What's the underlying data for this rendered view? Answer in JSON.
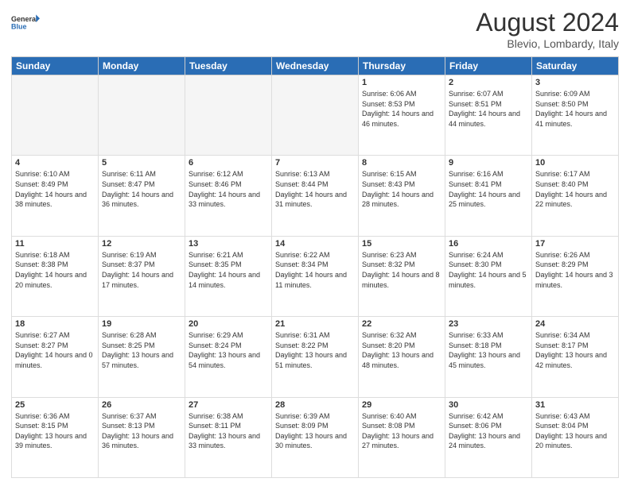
{
  "logo": {
    "line1": "General",
    "line2": "Blue"
  },
  "title": "August 2024",
  "subtitle": "Blevio, Lombardy, Italy",
  "weekdays": [
    "Sunday",
    "Monday",
    "Tuesday",
    "Wednesday",
    "Thursday",
    "Friday",
    "Saturday"
  ],
  "weeks": [
    [
      {
        "day": "",
        "info": ""
      },
      {
        "day": "",
        "info": ""
      },
      {
        "day": "",
        "info": ""
      },
      {
        "day": "",
        "info": ""
      },
      {
        "day": "1",
        "info": "Sunrise: 6:06 AM\nSunset: 8:53 PM\nDaylight: 14 hours and 46 minutes."
      },
      {
        "day": "2",
        "info": "Sunrise: 6:07 AM\nSunset: 8:51 PM\nDaylight: 14 hours and 44 minutes."
      },
      {
        "day": "3",
        "info": "Sunrise: 6:09 AM\nSunset: 8:50 PM\nDaylight: 14 hours and 41 minutes."
      }
    ],
    [
      {
        "day": "4",
        "info": "Sunrise: 6:10 AM\nSunset: 8:49 PM\nDaylight: 14 hours and 38 minutes."
      },
      {
        "day": "5",
        "info": "Sunrise: 6:11 AM\nSunset: 8:47 PM\nDaylight: 14 hours and 36 minutes."
      },
      {
        "day": "6",
        "info": "Sunrise: 6:12 AM\nSunset: 8:46 PM\nDaylight: 14 hours and 33 minutes."
      },
      {
        "day": "7",
        "info": "Sunrise: 6:13 AM\nSunset: 8:44 PM\nDaylight: 14 hours and 31 minutes."
      },
      {
        "day": "8",
        "info": "Sunrise: 6:15 AM\nSunset: 8:43 PM\nDaylight: 14 hours and 28 minutes."
      },
      {
        "day": "9",
        "info": "Sunrise: 6:16 AM\nSunset: 8:41 PM\nDaylight: 14 hours and 25 minutes."
      },
      {
        "day": "10",
        "info": "Sunrise: 6:17 AM\nSunset: 8:40 PM\nDaylight: 14 hours and 22 minutes."
      }
    ],
    [
      {
        "day": "11",
        "info": "Sunrise: 6:18 AM\nSunset: 8:38 PM\nDaylight: 14 hours and 20 minutes."
      },
      {
        "day": "12",
        "info": "Sunrise: 6:19 AM\nSunset: 8:37 PM\nDaylight: 14 hours and 17 minutes."
      },
      {
        "day": "13",
        "info": "Sunrise: 6:21 AM\nSunset: 8:35 PM\nDaylight: 14 hours and 14 minutes."
      },
      {
        "day": "14",
        "info": "Sunrise: 6:22 AM\nSunset: 8:34 PM\nDaylight: 14 hours and 11 minutes."
      },
      {
        "day": "15",
        "info": "Sunrise: 6:23 AM\nSunset: 8:32 PM\nDaylight: 14 hours and 8 minutes."
      },
      {
        "day": "16",
        "info": "Sunrise: 6:24 AM\nSunset: 8:30 PM\nDaylight: 14 hours and 5 minutes."
      },
      {
        "day": "17",
        "info": "Sunrise: 6:26 AM\nSunset: 8:29 PM\nDaylight: 14 hours and 3 minutes."
      }
    ],
    [
      {
        "day": "18",
        "info": "Sunrise: 6:27 AM\nSunset: 8:27 PM\nDaylight: 14 hours and 0 minutes."
      },
      {
        "day": "19",
        "info": "Sunrise: 6:28 AM\nSunset: 8:25 PM\nDaylight: 13 hours and 57 minutes."
      },
      {
        "day": "20",
        "info": "Sunrise: 6:29 AM\nSunset: 8:24 PM\nDaylight: 13 hours and 54 minutes."
      },
      {
        "day": "21",
        "info": "Sunrise: 6:31 AM\nSunset: 8:22 PM\nDaylight: 13 hours and 51 minutes."
      },
      {
        "day": "22",
        "info": "Sunrise: 6:32 AM\nSunset: 8:20 PM\nDaylight: 13 hours and 48 minutes."
      },
      {
        "day": "23",
        "info": "Sunrise: 6:33 AM\nSunset: 8:18 PM\nDaylight: 13 hours and 45 minutes."
      },
      {
        "day": "24",
        "info": "Sunrise: 6:34 AM\nSunset: 8:17 PM\nDaylight: 13 hours and 42 minutes."
      }
    ],
    [
      {
        "day": "25",
        "info": "Sunrise: 6:36 AM\nSunset: 8:15 PM\nDaylight: 13 hours and 39 minutes."
      },
      {
        "day": "26",
        "info": "Sunrise: 6:37 AM\nSunset: 8:13 PM\nDaylight: 13 hours and 36 minutes."
      },
      {
        "day": "27",
        "info": "Sunrise: 6:38 AM\nSunset: 8:11 PM\nDaylight: 13 hours and 33 minutes."
      },
      {
        "day": "28",
        "info": "Sunrise: 6:39 AM\nSunset: 8:09 PM\nDaylight: 13 hours and 30 minutes."
      },
      {
        "day": "29",
        "info": "Sunrise: 6:40 AM\nSunset: 8:08 PM\nDaylight: 13 hours and 27 minutes."
      },
      {
        "day": "30",
        "info": "Sunrise: 6:42 AM\nSunset: 8:06 PM\nDaylight: 13 hours and 24 minutes."
      },
      {
        "day": "31",
        "info": "Sunrise: 6:43 AM\nSunset: 8:04 PM\nDaylight: 13 hours and 20 minutes."
      }
    ]
  ]
}
